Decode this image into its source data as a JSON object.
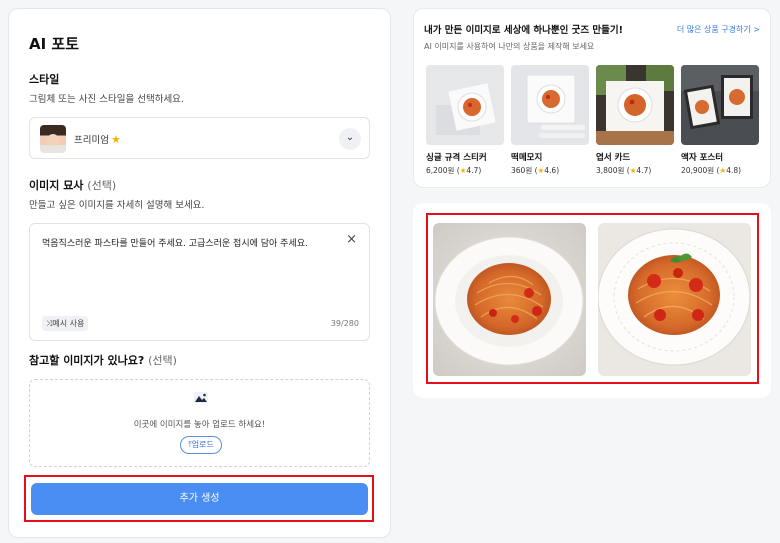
{
  "page": {
    "title": "AI 포토",
    "style_section": {
      "label": "스타일",
      "help": "그림체 또는 사진 스타일을 선택하세요.",
      "selected": "프리미엄",
      "star_icon": "star-icon"
    },
    "description_section": {
      "label": "이미지 묘사",
      "optional": "(선택)",
      "help": "만들고 싶은 이미지를 자세히 설명해 보세요.",
      "value": "먹음직스러운 파스타를 만들어 주세요. 고급스러운 접시에 담아 주세요.",
      "example_label": "예시 사용",
      "char_count": "39/280"
    },
    "reference_section": {
      "label": "참고할 이미지가 있나요?",
      "optional": "(선택)",
      "hint": "이곳에 이미지를 놓아 업로드 하세요!",
      "upload_label": "업로드"
    },
    "generate_label": "추가 생성"
  },
  "goods": {
    "title": "내가 만든 이미지로 세상에 하나뿐인 굿즈 만들기!",
    "subtitle": "AI 이미지를 사용하여 나만의 상품을 제작해 보세요",
    "more_link": "더 많은 상품 구경하기 >",
    "products": [
      {
        "name": "싱글 규격 스티커",
        "price": "6,200원 (",
        "rating": "4.7",
        "close": ")"
      },
      {
        "name": "떡메모지",
        "price": "360원 (",
        "rating": "4.6",
        "close": ")"
      },
      {
        "name": "엽서 카드",
        "price": "3,800원 (",
        "rating": "4.7",
        "close": ")"
      },
      {
        "name": "액자 포스터",
        "price": "20,900원 (",
        "rating": "4.8",
        "close": ")"
      }
    ]
  },
  "colors": {
    "accent": "#4a8ef3",
    "highlight": "#e3101b",
    "star": "#f5b400"
  }
}
